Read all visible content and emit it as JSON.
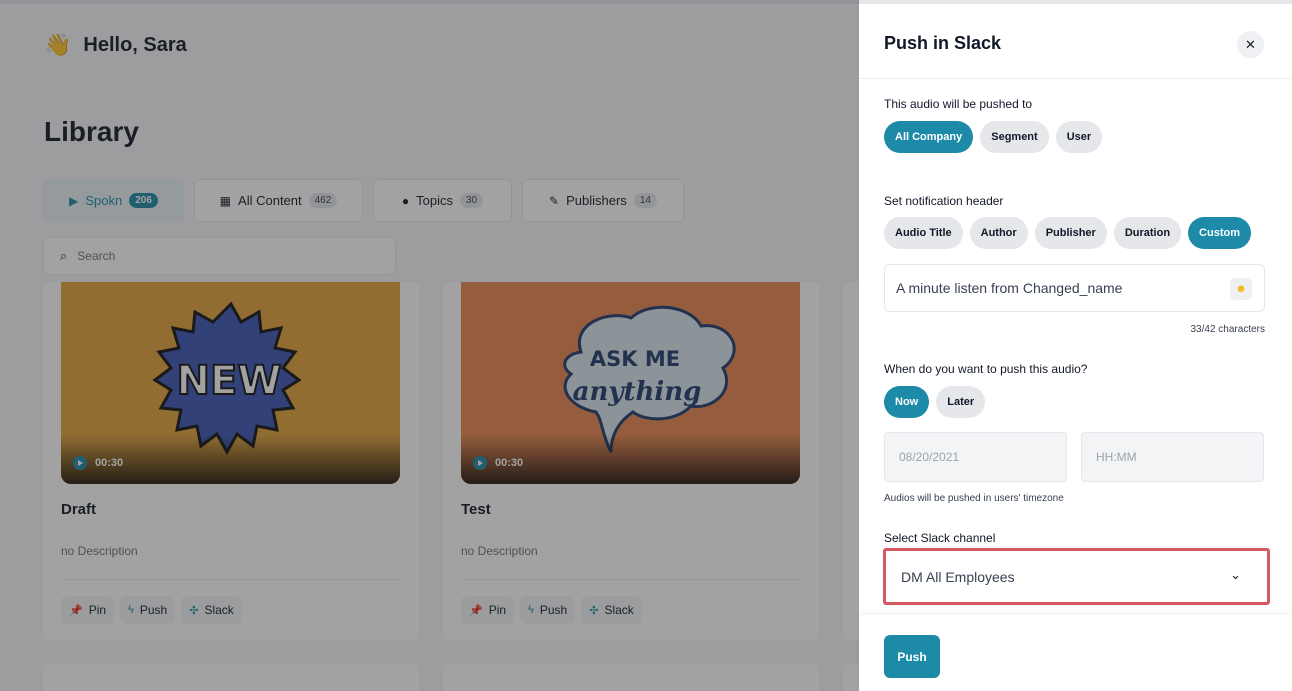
{
  "page": {
    "greeting": "Hello, Sara",
    "title": "Library",
    "tabs": [
      {
        "label": "Spokn",
        "count": "206",
        "icon": "play-icon"
      },
      {
        "label": "All Content",
        "count": "462",
        "icon": "grid-icon"
      },
      {
        "label": "Topics",
        "count": "30",
        "icon": "chat-bubble-icon"
      },
      {
        "label": "Publishers",
        "count": "14",
        "icon": "pen-icon"
      }
    ],
    "search_placeholder": "Search",
    "cards": [
      {
        "title": "Draft",
        "description": "no Description",
        "duration": "00:30",
        "thumb_text": "NEW"
      },
      {
        "title": "Test",
        "description": "no Description",
        "duration": "00:30",
        "thumb_text_1": "ASK ME",
        "thumb_text_2": "anything"
      }
    ],
    "card_actions": {
      "pin": "Pin",
      "push": "Push",
      "slack": "Slack"
    }
  },
  "drawer": {
    "title": "Push in Slack",
    "audience_label": "This audio will be pushed to",
    "audience_options": [
      "All Company",
      "Segment",
      "User"
    ],
    "audience_selected": "All Company",
    "header_label": "Set notification header",
    "header_options": [
      "Audio Title",
      "Author",
      "Publisher",
      "Duration",
      "Custom"
    ],
    "header_selected": "Custom",
    "header_value": "A minute listen from Changed_name",
    "char_count": "33/42 characters",
    "when_label": "When do you want to push this audio?",
    "when_options": [
      "Now",
      "Later"
    ],
    "when_selected": "Now",
    "date_placeholder": "08/20/2021",
    "time_placeholder": "HH:MM",
    "timezone_note": "Audios will be pushed in users' timezone",
    "channel_label": "Select Slack channel",
    "channel_value": "DM All Employees",
    "push_button": "Push"
  },
  "colors": {
    "accent": "#1d8aa8",
    "highlight_border": "#d75a63"
  }
}
